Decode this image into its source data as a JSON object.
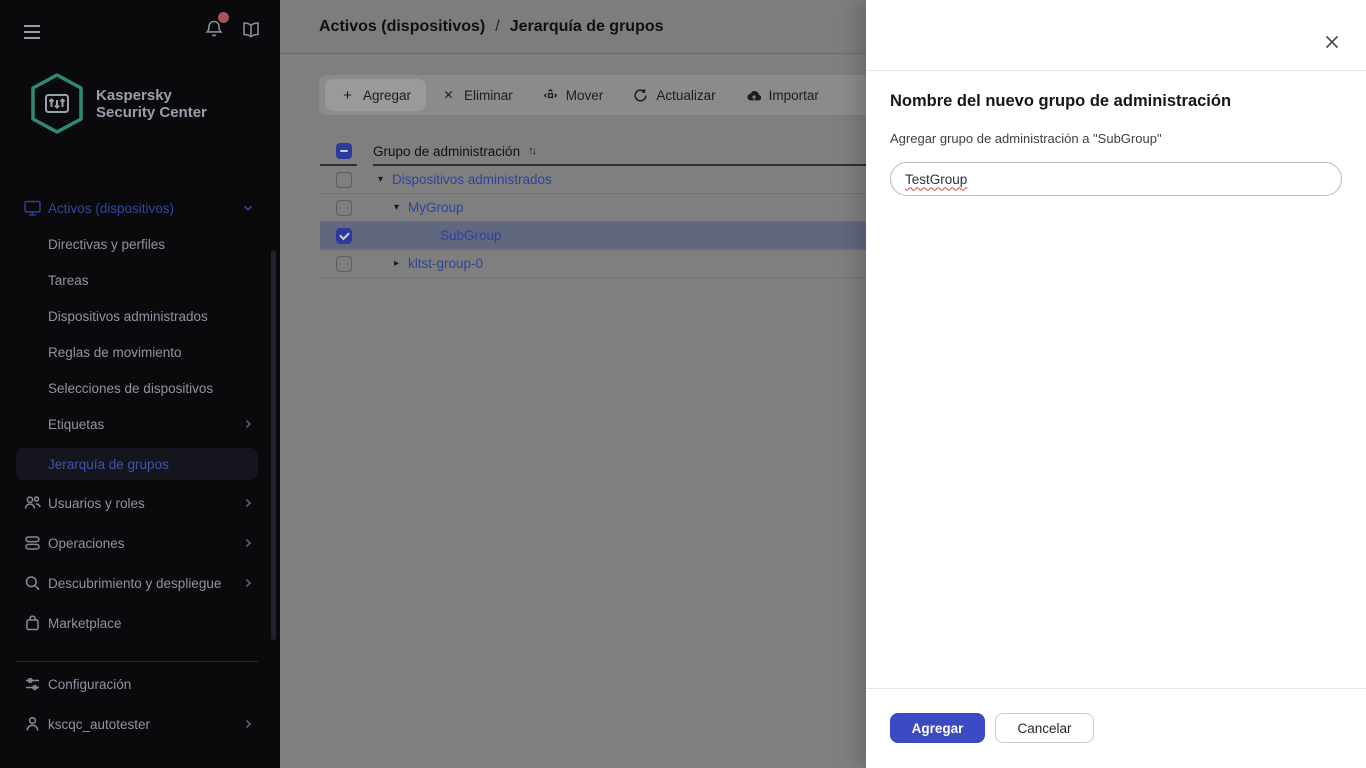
{
  "app": {
    "logo_line1": "Kaspersky",
    "logo_line2": "Security Center"
  },
  "sidebar": {
    "nav": [
      {
        "label": "Activos (dispositivos)",
        "icon": "monitor-icon",
        "state": "expanded",
        "accent": true
      },
      {
        "label": "Directivas y perfiles"
      },
      {
        "label": "Tareas"
      },
      {
        "label": "Dispositivos administrados"
      },
      {
        "label": "Reglas de movimiento"
      },
      {
        "label": "Selecciones de dispositivos"
      },
      {
        "label": "Etiquetas",
        "chevron": "right"
      },
      {
        "label": "Jerarquía de grupos",
        "active": true
      },
      {
        "label": "Usuarios y roles",
        "icon": "users-icon",
        "chevron": "right"
      },
      {
        "label": "Operaciones",
        "icon": "layers-icon",
        "chevron": "right"
      },
      {
        "label": "Descubrimiento y despliegue",
        "icon": "search-icon",
        "chevron": "right"
      },
      {
        "label": "Marketplace",
        "icon": "bag-icon"
      }
    ],
    "footer_nav": [
      {
        "label": "Configuración",
        "icon": "sliders-icon"
      },
      {
        "label": "kscqc_autotester",
        "icon": "user-icon",
        "chevron": "right"
      }
    ],
    "notification_badge": true
  },
  "breadcrumb": {
    "items": [
      "Activos (dispositivos)",
      "Jerarquía de grupos"
    ],
    "separator": "/"
  },
  "toolbar": {
    "buttons": [
      {
        "label": "Agregar",
        "icon": "plus-icon"
      },
      {
        "label": "Eliminar",
        "icon": "x-icon"
      },
      {
        "label": "Mover",
        "icon": "move-icon"
      },
      {
        "label": "Actualizar",
        "icon": "refresh-icon"
      },
      {
        "label": "Importar",
        "icon": "cloud-upload-icon"
      }
    ],
    "plus_glyph": "+",
    "x_glyph": "✕"
  },
  "table": {
    "select_all_state": "indeterminate",
    "columns": [
      {
        "label": "Grupo de administración",
        "sort_icon": "↑↓"
      }
    ],
    "rows": [
      {
        "label": "Dispositivos administrados",
        "level": 0,
        "arrow": "▾",
        "checked": false,
        "selected": false
      },
      {
        "label": "MyGroup",
        "level": 1,
        "arrow": "▾",
        "checked": false,
        "selected": false
      },
      {
        "label": "SubGroup",
        "level": 2,
        "arrow": "",
        "checked": true,
        "selected": true
      },
      {
        "label": "kltst-group-0",
        "level": 1,
        "arrow": "▸",
        "checked": false,
        "selected": false
      }
    ]
  },
  "drawer": {
    "title": "Nombre del nuevo grupo de administración",
    "field_label": "Agregar grupo de administración a \"SubGroup\"",
    "input_value": "TestGroup",
    "primary_button": "Agregar",
    "secondary_button": "Cancelar"
  },
  "colors": {
    "primary_blue": "#3b49c3",
    "logo_teal": "#2d8b75",
    "badge_red": "#a95454",
    "link_blue_dimmed": "#2a449e"
  }
}
